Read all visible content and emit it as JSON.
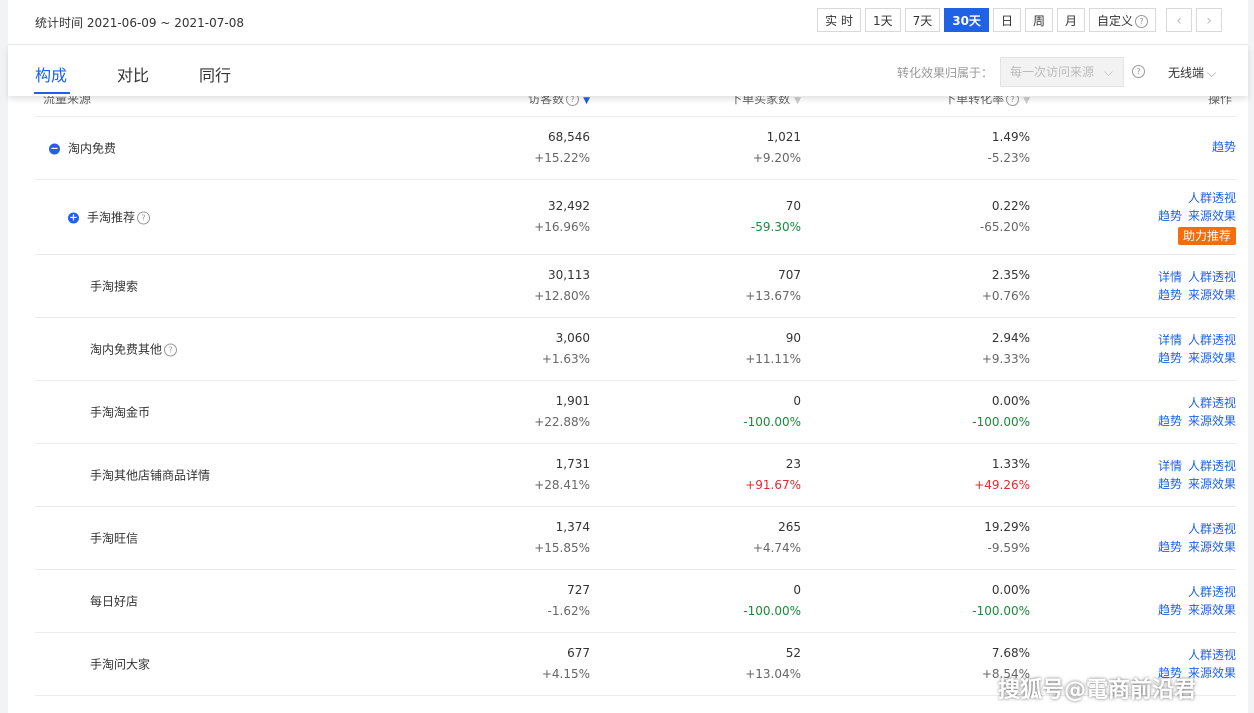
{
  "period": "统计时间 2021-06-09 ~ 2021-07-08",
  "period_buttons": [
    "实 时",
    "1天",
    "7天",
    "30天",
    "日",
    "周",
    "月",
    "自定义"
  ],
  "nav_prev": "‹",
  "nav_next": "›",
  "tabs": [
    "构成",
    "对比",
    "同行"
  ],
  "attribution": {
    "label": "转化效果归属于：",
    "value": "每一次访问来源"
  },
  "device": "无线端",
  "columns": [
    "流量来源",
    "访客数",
    "下单买家数",
    "下单转化率",
    "操作"
  ],
  "rows": [
    {
      "name": "淘内免费",
      "v1": "68,546",
      "c1": "+15.22%",
      "v2": "1,021",
      "c2": "+9.20%",
      "v3": "1.49%",
      "c3": "-5.23%",
      "ops": [
        "趋势"
      ]
    },
    {
      "name": "手淘推荐",
      "v1": "32,492",
      "c1": "+16.96%",
      "v2": "70",
      "c2": "-59.30%",
      "v3": "0.22%",
      "c3": "-65.20%",
      "ops": [
        "人群透视",
        "趋势",
        "来源效果"
      ],
      "badge": "助力推荐"
    },
    {
      "name": "手淘搜索",
      "v1": "30,113",
      "c1": "+12.80%",
      "v2": "707",
      "c2": "+13.67%",
      "v3": "2.35%",
      "c3": "+0.76%",
      "ops": [
        "详情",
        "人群透视",
        "趋势",
        "来源效果"
      ]
    },
    {
      "name": "淘内免费其他",
      "v1": "3,060",
      "c1": "+1.63%",
      "v2": "90",
      "c2": "+11.11%",
      "v3": "2.94%",
      "c3": "+9.33%",
      "ops": [
        "详情",
        "人群透视",
        "趋势",
        "来源效果"
      ]
    },
    {
      "name": "手淘淘金币",
      "v1": "1,901",
      "c1": "+22.88%",
      "v2": "0",
      "c2": "-100.00%",
      "v3": "0.00%",
      "c3": "-100.00%",
      "ops": [
        "人群透视",
        "趋势",
        "来源效果"
      ]
    },
    {
      "name": "手淘其他店铺商品详情",
      "v1": "1,731",
      "c1": "+28.41%",
      "v2": "23",
      "c2": "+91.67%",
      "v3": "1.33%",
      "c3": "+49.26%",
      "ops": [
        "详情",
        "人群透视",
        "趋势",
        "来源效果"
      ]
    },
    {
      "name": "手淘旺信",
      "v1": "1,374",
      "c1": "+15.85%",
      "v2": "265",
      "c2": "+4.74%",
      "v3": "19.29%",
      "c3": "-9.59%",
      "ops": [
        "人群透视",
        "趋势",
        "来源效果"
      ]
    },
    {
      "name": "每日好店",
      "v1": "727",
      "c1": "-1.62%",
      "v2": "0",
      "c2": "-100.00%",
      "v3": "0.00%",
      "c3": "-100.00%",
      "ops": [
        "人群透视",
        "趋势",
        "来源效果"
      ]
    },
    {
      "name": "手淘问大家",
      "v1": "677",
      "c1": "+4.15%",
      "v2": "52",
      "c2": "+13.04%",
      "v3": "7.68%",
      "c3": "+8.54%",
      "ops": [
        "人群透视",
        "趋势",
        "来源效果"
      ]
    }
  ],
  "watermark": "搜狐号@電商前沿君",
  "colors": {
    "accent": "#2062e6",
    "positive": "#e0292f",
    "negative": "#1a8a3a",
    "badge": "#f26d0d"
  }
}
